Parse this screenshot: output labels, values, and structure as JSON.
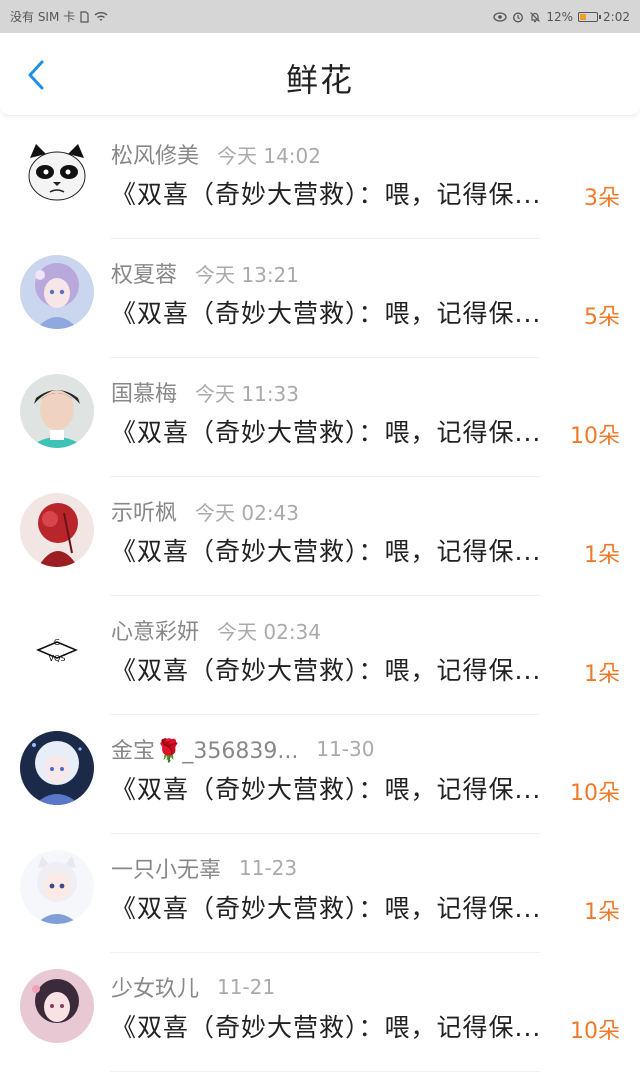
{
  "statusbar": {
    "carrier": "没有 SIM 卡",
    "battery": "12%",
    "time": "2:02"
  },
  "header": {
    "title": "鲜花"
  },
  "items": [
    {
      "name": "松风修美",
      "time": "今天 14:02",
      "message": "《双喜（奇妙大营救）：喂，记得保...",
      "count": "3朵"
    },
    {
      "name": "权夏蓉",
      "time": "今天 13:21",
      "message": "《双喜（奇妙大营救）：喂，记得保...",
      "count": "5朵"
    },
    {
      "name": "国慕梅",
      "time": "今天 11:33",
      "message": "《双喜（奇妙大营救）：喂，记得保...",
      "count": "10朵"
    },
    {
      "name": "示听枫",
      "time": "今天 02:43",
      "message": "《双喜（奇妙大营救）：喂，记得保...",
      "count": "1朵"
    },
    {
      "name": "心意彩妍",
      "time": "今天 02:34",
      "message": "《双喜（奇妙大营救）：喂，记得保...",
      "count": "1朵"
    },
    {
      "name": "金宝🌹_356839...",
      "time": "11-30",
      "message": "《双喜（奇妙大营救）：喂，记得保...",
      "count": "10朵"
    },
    {
      "name": "一只小无辜",
      "time": "11-23",
      "message": "《双喜（奇妙大营救）：喂，记得保...",
      "count": "1朵"
    },
    {
      "name": "少女玖儿",
      "time": "11-21",
      "message": "《双喜（奇妙大营救）：喂，记得保...",
      "count": "10朵"
    }
  ],
  "avatar_text": {
    "vqs_top": "G",
    "vqs_bottom": "VQS"
  }
}
